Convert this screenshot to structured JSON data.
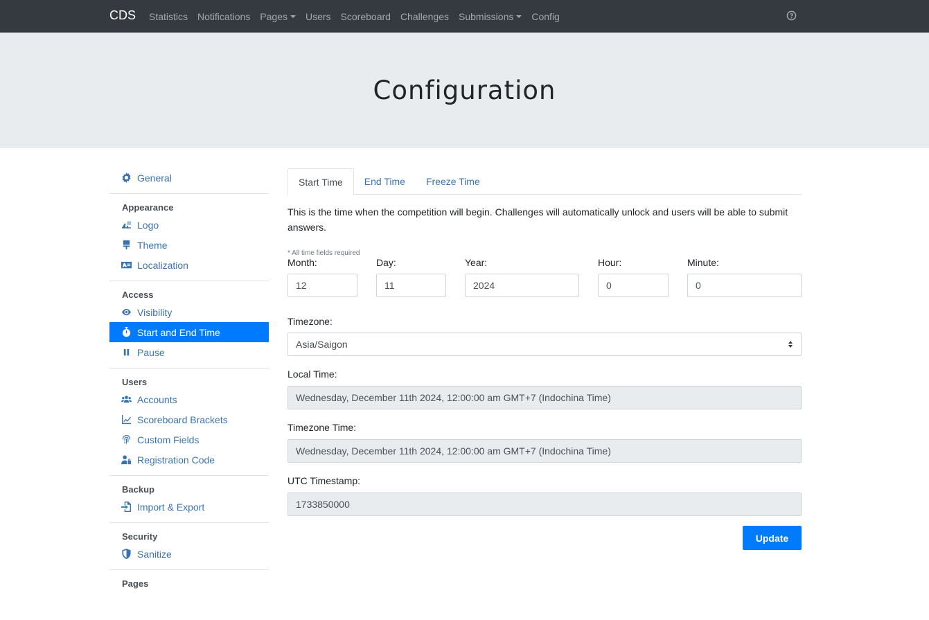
{
  "navbar": {
    "brand": "CDS",
    "items": [
      {
        "label": "Statistics"
      },
      {
        "label": "Notifications"
      },
      {
        "label": "Pages"
      },
      {
        "label": "Users"
      },
      {
        "label": "Scoreboard"
      },
      {
        "label": "Challenges"
      },
      {
        "label": "Submissions"
      },
      {
        "label": "Config"
      }
    ]
  },
  "page": {
    "title": "Configuration"
  },
  "sidebar": {
    "general": "General",
    "appearance": {
      "header": "Appearance",
      "logo": "Logo",
      "theme": "Theme",
      "localization": "Localization"
    },
    "access": {
      "header": "Access",
      "visibility": "Visibility",
      "start_end": "Start and End Time",
      "pause": "Pause"
    },
    "users": {
      "header": "Users",
      "accounts": "Accounts",
      "brackets": "Scoreboard Brackets",
      "custom_fields": "Custom Fields",
      "registration_code": "Registration Code"
    },
    "backup": {
      "header": "Backup",
      "import_export": "Import & Export"
    },
    "security": {
      "header": "Security",
      "sanitize": "Sanitize"
    },
    "pages": {
      "header": "Pages"
    }
  },
  "tabs": {
    "start": "Start Time",
    "end": "End Time",
    "freeze": "Freeze Time"
  },
  "form": {
    "description": "This is the time when the competition will begin. Challenges will automatically unlock and users will be able to submit answers.",
    "required_note": "* All time fields required",
    "month": {
      "label": "Month:",
      "value": "12"
    },
    "day": {
      "label": "Day:",
      "value": "11"
    },
    "year": {
      "label": "Year:",
      "value": "2024"
    },
    "hour": {
      "label": "Hour:",
      "value": "0"
    },
    "minute": {
      "label": "Minute:",
      "value": "0"
    },
    "timezone": {
      "label": "Timezone:",
      "value": "Asia/Saigon"
    },
    "local_time": {
      "label": "Local Time:",
      "value": "Wednesday, December 11th 2024, 12:00:00 am GMT+7 (Indochina Time)"
    },
    "timezone_time": {
      "label": "Timezone Time:",
      "value": "Wednesday, December 11th 2024, 12:00:00 am GMT+7 (Indochina Time)"
    },
    "utc": {
      "label": "UTC Timestamp:",
      "value": "1733850000"
    },
    "update": "Update"
  }
}
